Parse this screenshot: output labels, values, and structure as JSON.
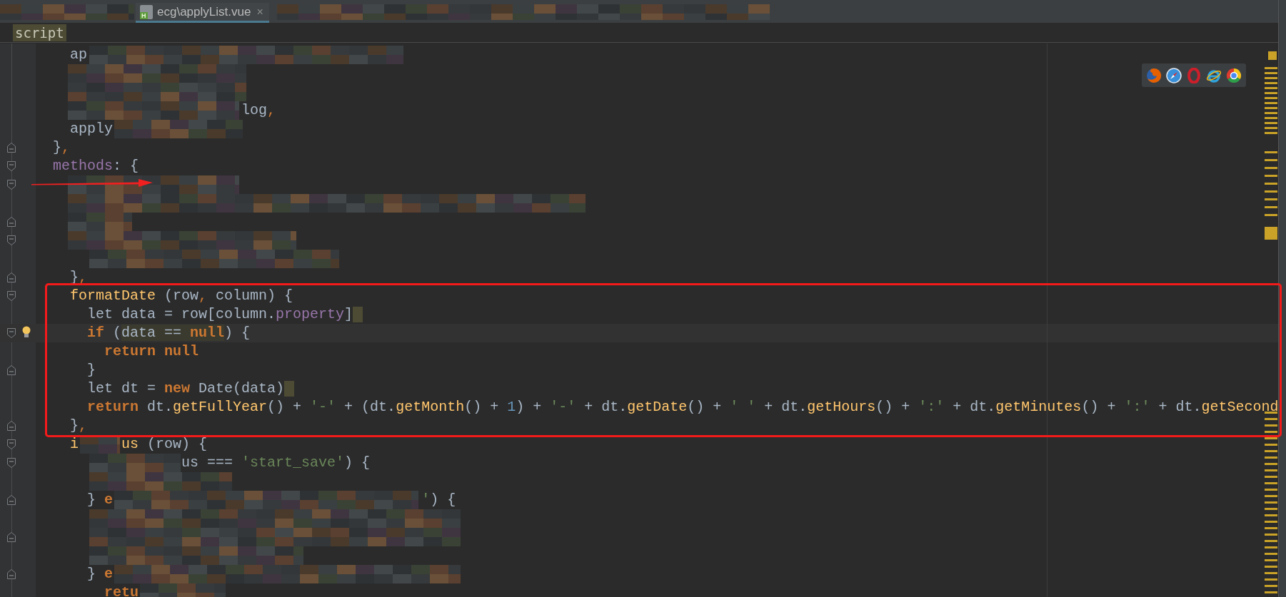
{
  "editor_tab": {
    "badge": "H",
    "title": "ecg\\applyList.vue",
    "close": "×",
    "selected": true
  },
  "breadcrumb": "script",
  "code_lines": [
    {
      "kind": "code",
      "parts": [
        [
          {
            "t": "    ap",
            "kind": "plain"
          }
        ]
      ]
    },
    {
      "kind": "blank"
    },
    {
      "kind": "blank"
    },
    {
      "kind": "code",
      "parts": [
        [
          {
            "t": "                        log",
            "kind": "plain"
          },
          {
            "t": ",",
            "kind": "punct"
          }
        ]
      ]
    },
    {
      "kind": "code",
      "parts": [
        [
          {
            "t": "    apply",
            "kind": "plain"
          }
        ]
      ]
    },
    {
      "kind": "code",
      "fold_end": true,
      "parts": [
        [
          {
            "t": "  }",
            "kind": "plain"
          },
          {
            "t": ",",
            "kind": "punct"
          }
        ]
      ]
    },
    {
      "kind": "code",
      "fold_start": true,
      "parts": [
        [
          {
            "t": "  methods",
            "kind": "member"
          },
          {
            "t": ": {",
            "kind": "plain"
          }
        ]
      ]
    },
    {
      "kind": "blank",
      "fold_start": true
    },
    {
      "kind": "blank"
    },
    {
      "kind": "blank",
      "fold_end": true
    },
    {
      "kind": "blank",
      "fold_start": true
    },
    {
      "kind": "blank"
    },
    {
      "kind": "code",
      "fold_end": true,
      "parts": [
        [
          {
            "t": "    }",
            "kind": "plain"
          },
          {
            "t": ",",
            "kind": "punct"
          }
        ]
      ]
    },
    {
      "kind": "code",
      "fold_start": true,
      "parts": [
        [
          {
            "t": "    formatDate",
            "kind": "function"
          },
          {
            "t": " (row",
            "kind": "plain"
          },
          {
            "t": ",",
            "kind": "punct"
          },
          {
            "t": " column) {",
            "kind": "plain"
          }
        ]
      ]
    },
    {
      "kind": "code",
      "marker": true,
      "parts": [
        [
          {
            "t": "      let data = row[column.",
            "kind": "plain"
          },
          {
            "t": "property",
            "kind": "member"
          },
          {
            "t": "]",
            "kind": "plain"
          }
        ]
      ]
    },
    {
      "kind": "code",
      "fold_start": true,
      "current": true,
      "bulb": true,
      "parts": [
        [
          {
            "t": "      if",
            "kind": "keyword"
          },
          {
            "t": " (",
            "kind": "plain"
          },
          {
            "t": "data == ",
            "kind": "plain",
            "hl": true
          },
          {
            "t": "null",
            "kind": "keyword",
            "hl": true
          },
          {
            "t": ") {",
            "kind": "plain"
          }
        ]
      ]
    },
    {
      "kind": "code",
      "parts": [
        [
          {
            "t": "        return null",
            "kind": "keyword"
          }
        ]
      ]
    },
    {
      "kind": "code",
      "fold_end": true,
      "parts": [
        [
          {
            "t": "      }",
            "kind": "plain"
          }
        ]
      ]
    },
    {
      "kind": "code",
      "marker": true,
      "parts": [
        [
          {
            "t": "      let dt = ",
            "kind": "plain"
          },
          {
            "t": "new",
            "kind": "keyword"
          },
          {
            "t": " Date(data)",
            "kind": "plain"
          }
        ]
      ]
    },
    {
      "kind": "code",
      "parts": [
        [
          {
            "t": "      return",
            "kind": "keyword"
          },
          {
            "t": " dt.",
            "kind": "plain"
          },
          {
            "t": "getFullYear",
            "kind": "function"
          },
          {
            "t": "() + ",
            "kind": "plain"
          },
          {
            "t": "'-'",
            "kind": "string"
          },
          {
            "t": " + (dt.",
            "kind": "plain"
          },
          {
            "t": "getMonth",
            "kind": "function"
          },
          {
            "t": "() + ",
            "kind": "plain"
          },
          {
            "t": "1",
            "kind": "number"
          },
          {
            "t": ") + ",
            "kind": "plain"
          },
          {
            "t": "'-'",
            "kind": "string"
          },
          {
            "t": " + dt.",
            "kind": "plain"
          },
          {
            "t": "getDate",
            "kind": "function"
          },
          {
            "t": "() + ",
            "kind": "plain"
          },
          {
            "t": "' '",
            "kind": "string"
          },
          {
            "t": " + dt.",
            "kind": "plain"
          },
          {
            "t": "getHours",
            "kind": "function"
          },
          {
            "t": "() + ",
            "kind": "plain"
          },
          {
            "t": "':'",
            "kind": "string"
          },
          {
            "t": " + dt.",
            "kind": "plain"
          },
          {
            "t": "getMinutes",
            "kind": "function"
          },
          {
            "t": "() + ",
            "kind": "plain"
          },
          {
            "t": "':'",
            "kind": "string"
          },
          {
            "t": " + dt.",
            "kind": "plain"
          },
          {
            "t": "getSecond",
            "kind": "function"
          }
        ]
      ]
    },
    {
      "kind": "code",
      "fold_end": true,
      "parts": [
        [
          {
            "t": "    }",
            "kind": "plain"
          },
          {
            "t": ",",
            "kind": "punct"
          }
        ]
      ]
    },
    {
      "kind": "code",
      "fold_start": true,
      "parts": [
        [
          {
            "t": "    i",
            "kind": "function"
          }
        ],
        [
          {
            "t": "     us",
            "kind": "function"
          },
          {
            "t": " (row) {",
            "kind": "plain"
          }
        ]
      ]
    },
    {
      "kind": "code",
      "fold_start": true,
      "parts": [
        [
          {
            "t": "                 us === ",
            "kind": "plain"
          },
          {
            "t": "'start_save'",
            "kind": "string"
          },
          {
            "t": ") {",
            "kind": "plain"
          }
        ]
      ]
    },
    {
      "kind": "blank"
    },
    {
      "kind": "code",
      "fold_end": true,
      "parts": [
        [
          {
            "t": "      }",
            "kind": "plain"
          },
          {
            "t": " e",
            "kind": "keyword"
          }
        ],
        [
          {
            "t": "                                    '",
            "kind": "string"
          },
          {
            "t": ") {",
            "kind": "plain"
          }
        ]
      ]
    },
    {
      "kind": "blank"
    },
    {
      "kind": "blank",
      "fold_end": true
    },
    {
      "kind": "blank"
    },
    {
      "kind": "code",
      "fold_end": true,
      "parts": [
        [
          {
            "t": "      }",
            "kind": "plain"
          },
          {
            "t": " e",
            "kind": "keyword"
          }
        ]
      ]
    },
    {
      "kind": "code",
      "parts": [
        [
          {
            "t": "        retu",
            "kind": "keyword"
          }
        ]
      ]
    }
  ],
  "browser_icons": [
    {
      "kind": "fox"
    },
    {
      "kind": "compass"
    },
    {
      "kind": "ring"
    },
    {
      "kind": "orbit"
    },
    {
      "kind": "tricolor"
    }
  ]
}
